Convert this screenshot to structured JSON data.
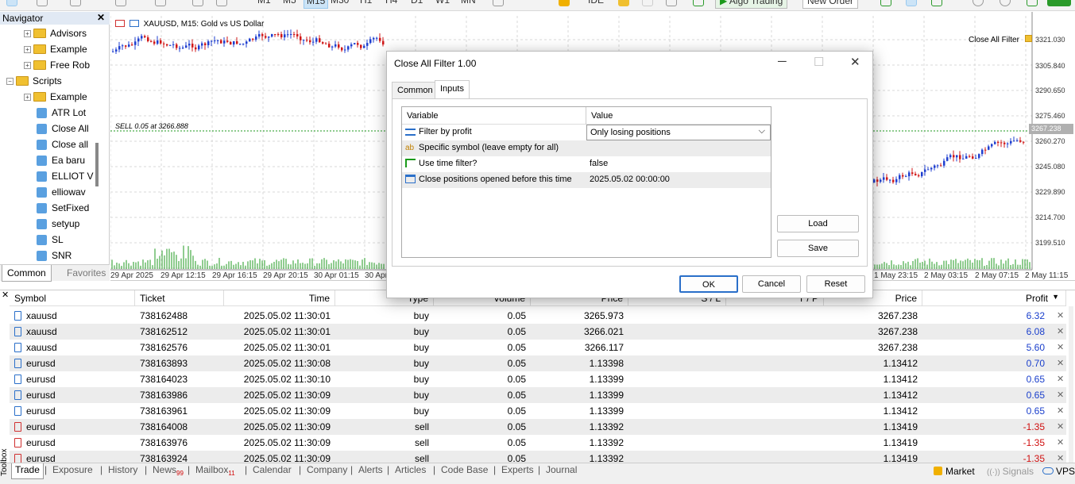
{
  "toolbar": {
    "timeframes": [
      "M1",
      "M5",
      "M15",
      "M30",
      "H1",
      "H4",
      "D1",
      "W1",
      "MN"
    ],
    "selected_timeframe": "M15",
    "ide_label": "IDE",
    "algo_label": "Algo Trading",
    "order_label": "New Order"
  },
  "navigator": {
    "title": "Navigator",
    "items": [
      {
        "label": "Advisors",
        "type": "folder"
      },
      {
        "label": "Example",
        "type": "folder"
      },
      {
        "label": "Free Rob",
        "type": "folder"
      },
      {
        "label": "Scripts",
        "type": "folder"
      },
      {
        "label": "Example",
        "type": "folder"
      },
      {
        "label": "ATR Lot",
        "type": "script"
      },
      {
        "label": "Close All",
        "type": "script"
      },
      {
        "label": "Close all",
        "type": "script"
      },
      {
        "label": "Ea baru",
        "type": "script"
      },
      {
        "label": "ELLIOT V",
        "type": "script"
      },
      {
        "label": "elliowav",
        "type": "script"
      },
      {
        "label": "SetFixed",
        "type": "script"
      },
      {
        "label": "setyup",
        "type": "script"
      },
      {
        "label": "SL",
        "type": "script"
      },
      {
        "label": "SNR",
        "type": "script"
      }
    ],
    "tabs": [
      "Common",
      "Favorites"
    ]
  },
  "chart": {
    "title": "XAUUSD, M15:  Gold vs US Dollar",
    "indicator_label": "Close All Filter",
    "sell_label": "SELL 0.05 at 3266.888",
    "price_levels": [
      "3321.030",
      "3305.840",
      "3290.650",
      "3275.460",
      "3260.270",
      "3245.080",
      "3229.890",
      "3214.700",
      "3199.510"
    ],
    "current_price": "3267.238",
    "time_labels_left": [
      "29 Apr 2025",
      "29 Apr 12:15",
      "29 Apr 16:15",
      "29 Apr 20:15",
      "30 Apr 01:15",
      "30 Apr"
    ],
    "time_labels_right": [
      "1 May 23:15",
      "2 May 03:15",
      "2 May 07:15",
      "2 May 11:15"
    ]
  },
  "dialog": {
    "title": "Close All Filter 1.00",
    "tabs": [
      "Common",
      "Inputs"
    ],
    "active_tab": "Inputs",
    "columns": [
      "Variable",
      "Value"
    ],
    "rows": [
      {
        "variable": "Filter by profit",
        "value": "Only losing positions",
        "icon": "list-icon"
      },
      {
        "variable": "Specific symbol (leave empty for all)",
        "value": "",
        "icon": "ab-icon"
      },
      {
        "variable": "Use time filter?",
        "value": "false",
        "icon": "arrow-icon"
      },
      {
        "variable": "Close positions opened before this time",
        "value": "2025.05.02 00:00:00",
        "icon": "calendar-icon"
      }
    ],
    "buttons": {
      "load": "Load",
      "save": "Save",
      "ok": "OK",
      "cancel": "Cancel",
      "reset": "Reset"
    },
    "ab_text": "ab"
  },
  "trades": {
    "columns": [
      "Symbol",
      "Ticket",
      "Time",
      "Type",
      "Volume",
      "Price",
      "S / L",
      "T / P",
      "Price",
      "Profit"
    ],
    "rows": [
      {
        "symbol": "xauusd",
        "ticket": "738162488",
        "time": "2025.05.02 11:30:01",
        "type": "buy",
        "volume": "0.05",
        "price": "3265.973",
        "sl": "",
        "tp": "",
        "cur": "3267.238",
        "profit": "6.32"
      },
      {
        "symbol": "xauusd",
        "ticket": "738162512",
        "time": "2025.05.02 11:30:01",
        "type": "buy",
        "volume": "0.05",
        "price": "3266.021",
        "sl": "",
        "tp": "",
        "cur": "3267.238",
        "profit": "6.08"
      },
      {
        "symbol": "xauusd",
        "ticket": "738162576",
        "time": "2025.05.02 11:30:01",
        "type": "buy",
        "volume": "0.05",
        "price": "3266.117",
        "sl": "",
        "tp": "",
        "cur": "3267.238",
        "profit": "5.60"
      },
      {
        "symbol": "eurusd",
        "ticket": "738163893",
        "time": "2025.05.02 11:30:08",
        "type": "buy",
        "volume": "0.05",
        "price": "1.13398",
        "sl": "",
        "tp": "",
        "cur": "1.13412",
        "profit": "0.70"
      },
      {
        "symbol": "eurusd",
        "ticket": "738164023",
        "time": "2025.05.02 11:30:10",
        "type": "buy",
        "volume": "0.05",
        "price": "1.13399",
        "sl": "",
        "tp": "",
        "cur": "1.13412",
        "profit": "0.65"
      },
      {
        "symbol": "eurusd",
        "ticket": "738163986",
        "time": "2025.05.02 11:30:09",
        "type": "buy",
        "volume": "0.05",
        "price": "1.13399",
        "sl": "",
        "tp": "",
        "cur": "1.13412",
        "profit": "0.65"
      },
      {
        "symbol": "eurusd",
        "ticket": "738163961",
        "time": "2025.05.02 11:30:09",
        "type": "buy",
        "volume": "0.05",
        "price": "1.13399",
        "sl": "",
        "tp": "",
        "cur": "1.13412",
        "profit": "0.65"
      },
      {
        "symbol": "eurusd",
        "ticket": "738164008",
        "time": "2025.05.02 11:30:09",
        "type": "sell",
        "volume": "0.05",
        "price": "1.13392",
        "sl": "",
        "tp": "",
        "cur": "1.13419",
        "profit": "-1.35"
      },
      {
        "symbol": "eurusd",
        "ticket": "738163976",
        "time": "2025.05.02 11:30:09",
        "type": "sell",
        "volume": "0.05",
        "price": "1.13392",
        "sl": "",
        "tp": "",
        "cur": "1.13419",
        "profit": "-1.35"
      },
      {
        "symbol": "eurusd",
        "ticket": "738163924",
        "time": "2025.05.02 11:30:09",
        "type": "sell",
        "volume": "0.05",
        "price": "1.13392",
        "sl": "",
        "tp": "",
        "cur": "1.13419",
        "profit": "-1.35"
      }
    ]
  },
  "bottom_tabs": {
    "toolbox": "Toolbox",
    "items": [
      {
        "label": "Trade"
      },
      {
        "label": "Exposure"
      },
      {
        "label": "History"
      },
      {
        "label": "News",
        "badge": "99"
      },
      {
        "label": "Mailbox",
        "badge": "11"
      },
      {
        "label": "Calendar"
      },
      {
        "label": "Company"
      },
      {
        "label": "Alerts"
      },
      {
        "label": "Articles"
      },
      {
        "label": "Code Base"
      },
      {
        "label": "Experts"
      },
      {
        "label": "Journal"
      }
    ],
    "market": "Market",
    "signals": "Signals",
    "vps": "VPS"
  },
  "colors": {
    "bull": "#1f3fd0",
    "bear": "#d01818",
    "volume": "#1f9a1f",
    "accent": "#2a6fc9"
  }
}
